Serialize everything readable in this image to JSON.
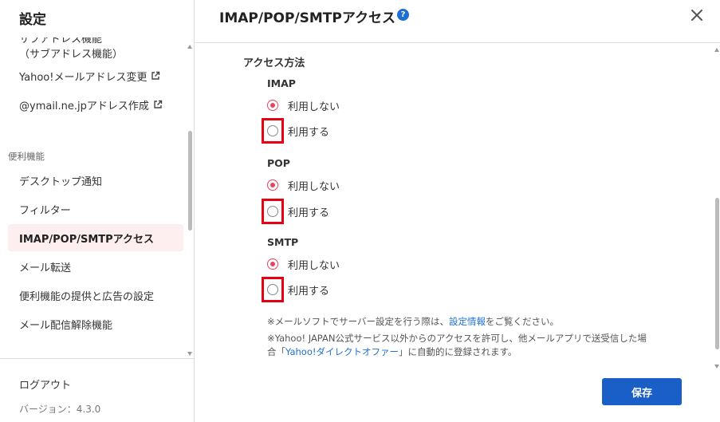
{
  "sidebar": {
    "title": "設定",
    "partial_item_line1": "サブアドレス機能",
    "partial_item_line2": "（サブアドレス機能）",
    "links": [
      {
        "label": "Yahoo!メールアドレス変更"
      },
      {
        "label": "@ymail.ne.jpアドレス作成"
      }
    ],
    "section_label": "便利機能",
    "items": [
      {
        "label": "デスクトップ通知"
      },
      {
        "label": "フィルター"
      },
      {
        "label": "IMAP/POP/SMTPアクセス"
      },
      {
        "label": "メール転送"
      },
      {
        "label": "便利機能の提供と広告の設定"
      },
      {
        "label": "メール配信解除機能"
      }
    ],
    "logout": "ログアウト",
    "version": "バージョン：4.3.0"
  },
  "header": {
    "title": "IMAP/POP/SMTPアクセス",
    "help": "?"
  },
  "main": {
    "section_title": "アクセス方法",
    "protocols": [
      {
        "name": "IMAP",
        "off_label": "利用しない",
        "on_label": "利用する",
        "selected": "off"
      },
      {
        "name": "POP",
        "off_label": "利用しない",
        "on_label": "利用する",
        "selected": "off"
      },
      {
        "name": "SMTP",
        "off_label": "利用しない",
        "on_label": "利用する",
        "selected": "off"
      }
    ],
    "note1_prefix": "※メールソフトでサーバー設定を行う際は、",
    "note1_link": "設定情報",
    "note1_suffix": "をご覧ください。",
    "note2_line1": "※Yahoo! JAPAN公式サービス以外からのアクセスを許可し、他メールアプリで送受信した場",
    "note2_prefix": "合「",
    "note2_link": "Yahoo!ダイレクトオファー",
    "note2_suffix": "」に自動的に登録されます。",
    "save_label": "保存"
  },
  "colors": {
    "accent": "#e6455f",
    "primary_button": "#1a5fc7",
    "highlight_box": "#e60012",
    "link": "#1e6fd0"
  }
}
